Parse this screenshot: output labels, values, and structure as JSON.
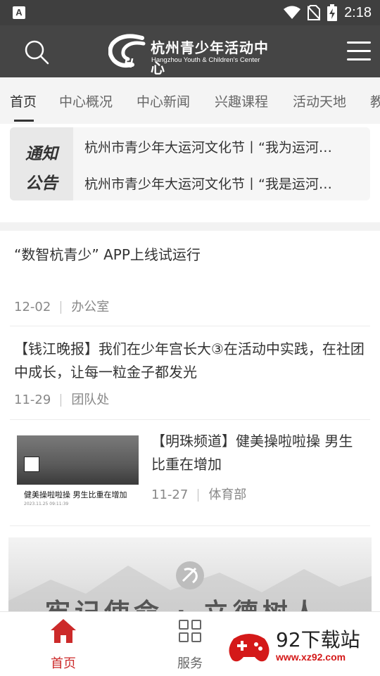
{
  "status_bar": {
    "time": "2:18"
  },
  "header": {
    "logo_cn": "杭州青少年活动中心",
    "logo_en": "Hangzhou Youth & Children's Center"
  },
  "tabs": [
    {
      "label": "首页"
    },
    {
      "label": "中心概况"
    },
    {
      "label": "中心新闻"
    },
    {
      "label": "兴趣课程"
    },
    {
      "label": "活动天地"
    },
    {
      "label": "教"
    }
  ],
  "notice": {
    "badge_line1": "通知",
    "badge_line2": "公告",
    "items": [
      "杭州市青少年大运河文化节丨“我为运河…",
      "杭州市青少年大运河文化节丨“我是运河…"
    ]
  },
  "news": [
    {
      "title": "“数智杭青少” APP上线试运行",
      "date": "12-02",
      "dept": "办公室"
    },
    {
      "title": "【钱江晚报】我们在少年宫长大③在活动中实践，在社团中成长，让每一粒金子都发光",
      "date": "11-29",
      "dept": "团队处"
    },
    {
      "title": "【明珠频道】健美操啦啦操 男生比重在增加",
      "date": "11-27",
      "dept": "体育部"
    }
  ],
  "thumb": {
    "caption": "健美操啦啦操 男生比重在增加",
    "stamp": "2023.11.25 09:11:39"
  },
  "banner": {
    "text": "牢记使命 · 立德树人"
  },
  "bottom_nav": [
    {
      "label": "首页"
    },
    {
      "label": "服务"
    }
  ],
  "watermark": {
    "title": "92下载站",
    "url": "www.xz92.com"
  },
  "colors": {
    "header_bg": "#454545",
    "statusbar_bg": "#3f3f3f",
    "active_nav": "#cc2a2a",
    "inactive_nav": "#666666",
    "watermark_red": "#d41919"
  }
}
